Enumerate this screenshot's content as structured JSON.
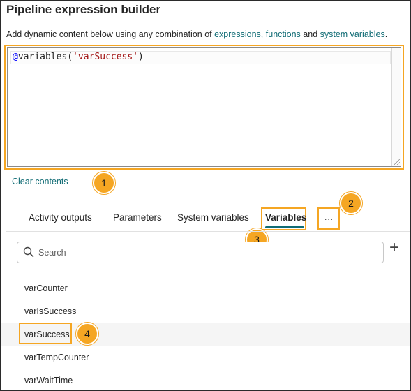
{
  "dialog": {
    "title": "Pipeline expression builder",
    "description_prefix": "Add dynamic content below using any combination of ",
    "link_expressions": "expressions,",
    "link_functions": "functions",
    "description_and": " and ",
    "link_system_variables": "system variables",
    "description_suffix": "."
  },
  "editor": {
    "at": "@",
    "func": "variables(",
    "arg": "'varSuccess'",
    "close": ")"
  },
  "clear_label": "Clear contents",
  "callouts": [
    "1",
    "2",
    "3",
    "4"
  ],
  "tabs": [
    {
      "label": "Activity outputs"
    },
    {
      "label": "Parameters"
    },
    {
      "label": "System variables"
    },
    {
      "label": "Variables",
      "active": true
    }
  ],
  "more_label": "···",
  "search": {
    "placeholder": "Search"
  },
  "add_label": "+",
  "variables": [
    {
      "name": "varCounter"
    },
    {
      "name": "varIsSuccess"
    },
    {
      "name": "varSuccess",
      "selected": true
    },
    {
      "name": "varTempCounter"
    },
    {
      "name": "varWaitTime"
    }
  ],
  "colors": {
    "accent_link": "#0f6b74",
    "callout": "#f5a623"
  }
}
